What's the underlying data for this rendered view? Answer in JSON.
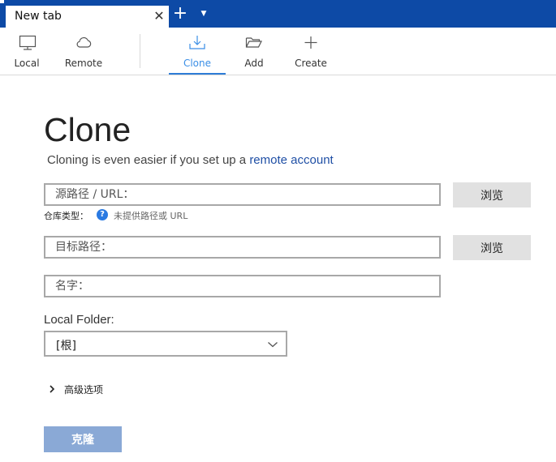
{
  "tabbar": {
    "tab_title": "New tab",
    "close_glyph": "✕",
    "new_tab_glyph": "+",
    "menu_glyph": "▼"
  },
  "toolbar": {
    "items": [
      {
        "label": "Local",
        "icon": "monitor-icon",
        "active": false
      },
      {
        "label": "Remote",
        "icon": "cloud-icon",
        "active": false
      },
      {
        "label": "Clone",
        "icon": "download-icon",
        "active": true
      },
      {
        "label": "Add",
        "icon": "folder-icon",
        "active": false
      },
      {
        "label": "Create",
        "icon": "plus-icon",
        "active": false
      }
    ]
  },
  "main": {
    "title": "Clone",
    "subtitle_prefix": "Cloning is even easier if you set up a ",
    "subtitle_link": "remote account",
    "source": {
      "placeholder": "源路径 / URL：",
      "value": ""
    },
    "browse_label": "浏览",
    "repo_type_label": "仓库类型：",
    "repo_type_hint": "未提供路径或 URL",
    "help_glyph": "?",
    "destination": {
      "placeholder": "目标路径：",
      "value": ""
    },
    "name": {
      "placeholder": "名字：",
      "value": ""
    },
    "local_folder_label": "Local Folder:",
    "local_folder_value": "[根]",
    "advanced_label": "高级选项",
    "clone_button": "克隆"
  },
  "colors": {
    "titlebar": "#0d4aa6",
    "accent": "#2e7dd7",
    "link": "#1f4fa5",
    "clone_button": "#8aa9d6",
    "browse_button": "#e1e1e1",
    "help_icon": "#2a7ae2"
  }
}
